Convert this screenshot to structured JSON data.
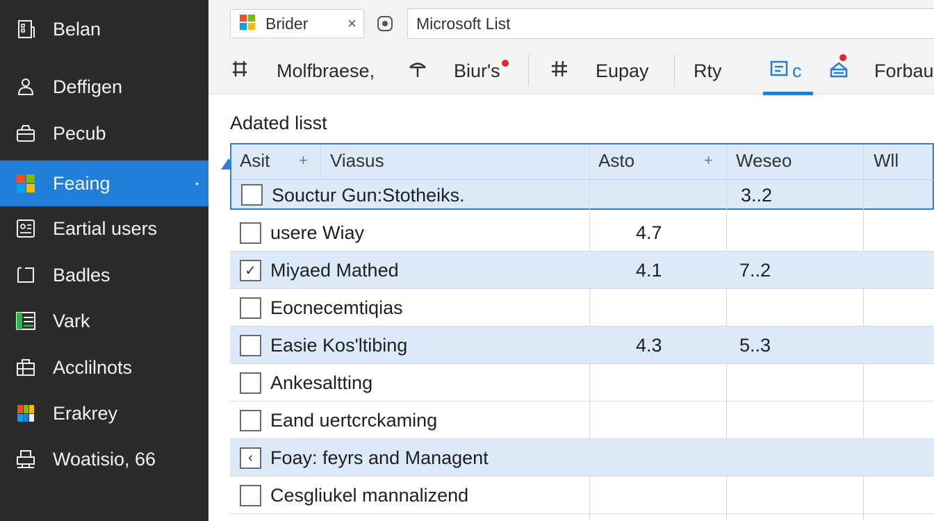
{
  "sidebar": {
    "items": [
      {
        "label": "Belan",
        "icon": "building-icon"
      },
      {
        "label": "Deffigen",
        "icon": "user-icon"
      },
      {
        "label": "Pecub",
        "icon": "basket-icon"
      },
      {
        "label": "Feaing",
        "icon": "microsoft-logo-icon",
        "active": true
      },
      {
        "label": "Eartial users",
        "icon": "id-card-icon"
      },
      {
        "label": "Badles",
        "icon": "folder-icon"
      },
      {
        "label": "Vark",
        "icon": "green-list-icon"
      },
      {
        "label": "Acclilnots",
        "icon": "toolbox-icon"
      },
      {
        "label": "Erakrey",
        "icon": "color-grid-icon"
      },
      {
        "label": "Woatisio, 66",
        "icon": "printer-icon"
      }
    ],
    "active_dot": "•"
  },
  "tab": {
    "label": "Brider",
    "close": "×"
  },
  "address": {
    "value": "Microsoft List"
  },
  "toolbar": {
    "items": [
      {
        "label": "Molfbraese,",
        "icon": "grid-hash-icon"
      },
      {
        "label": "Biur's",
        "icon": "pin-icon"
      },
      {
        "label": "Eupay",
        "icon": "hash-icon"
      },
      {
        "label": "Rty",
        "icon": ""
      },
      {
        "label": "c",
        "icon": "edit-box-icon"
      },
      {
        "label": "Forbau",
        "icon": "tray-icon"
      }
    ]
  },
  "list": {
    "title": "Adated lisst",
    "columns": [
      {
        "label": "Asit",
        "plus": "+"
      },
      {
        "label": "Viasus"
      },
      {
        "label": "Asto",
        "plus": "+"
      },
      {
        "label": "Weseo"
      },
      {
        "label": "Wll"
      }
    ],
    "selected_row": {
      "text": "Souctur Gun:Stotheiks.",
      "v1": "",
      "v2": "3..2"
    },
    "rows": [
      {
        "text": "usere Wiay",
        "v1": "4.7",
        "v2": "",
        "mark": "",
        "alt": false
      },
      {
        "text": "Miyaed Mathed",
        "v1": "4.1",
        "v2": "7..2",
        "mark": "✓",
        "alt": true
      },
      {
        "text": "Eocnecemtiqias",
        "v1": "",
        "v2": "",
        "mark": "",
        "alt": false
      },
      {
        "text": "Easie Kos'ltibing",
        "v1": "4.3",
        "v2": "5..3",
        "mark": "",
        "alt": true
      },
      {
        "text": "Ankesaltting",
        "v1": "",
        "v2": "",
        "mark": "",
        "alt": false
      },
      {
        "text": "Eand uertcrckaming",
        "v1": "",
        "v2": "",
        "mark": "",
        "alt": false
      },
      {
        "text": "Foay: feyrs and Managent",
        "v1": "",
        "v2": "",
        "mark": "‹",
        "alt": true
      },
      {
        "text": "Cesgliukel mannalizend",
        "v1": "",
        "v2": "",
        "mark": "",
        "alt": false
      }
    ]
  },
  "colors": {
    "sidebar_bg": "#2b2b2b",
    "accent": "#1f7fd9",
    "row_alt": "#dbe9f8",
    "notification": "#e0262b"
  }
}
